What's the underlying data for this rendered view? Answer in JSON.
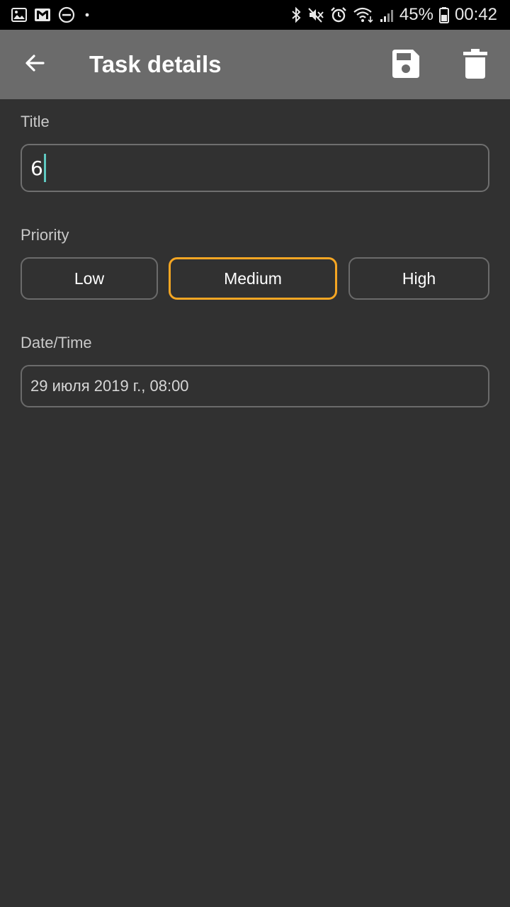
{
  "status_bar": {
    "battery_text": "45%",
    "time": "00:42",
    "icons_left": [
      "image-icon",
      "gmail-icon",
      "dnd-icon",
      "dot-icon"
    ],
    "icons_right": [
      "bluetooth-icon",
      "mute-icon",
      "alarm-icon",
      "wifi-icon",
      "signal-icon",
      "battery-icon"
    ]
  },
  "app_bar": {
    "title": "Task details",
    "back_icon": "arrow-back-icon",
    "save_icon": "save-icon",
    "delete_icon": "trash-icon"
  },
  "form": {
    "title_label": "Title",
    "title_value": "6",
    "priority_label": "Priority",
    "priority_options": [
      "Low",
      "Medium",
      "High"
    ],
    "priority_selected": "Medium",
    "datetime_label": "Date/Time",
    "datetime_value": "29 июля 2019 г., 08:00"
  },
  "colors": {
    "background": "#313131",
    "app_bar": "#6b6b6b",
    "accent_selected": "#f5a623",
    "caret": "#5fc8c0"
  }
}
